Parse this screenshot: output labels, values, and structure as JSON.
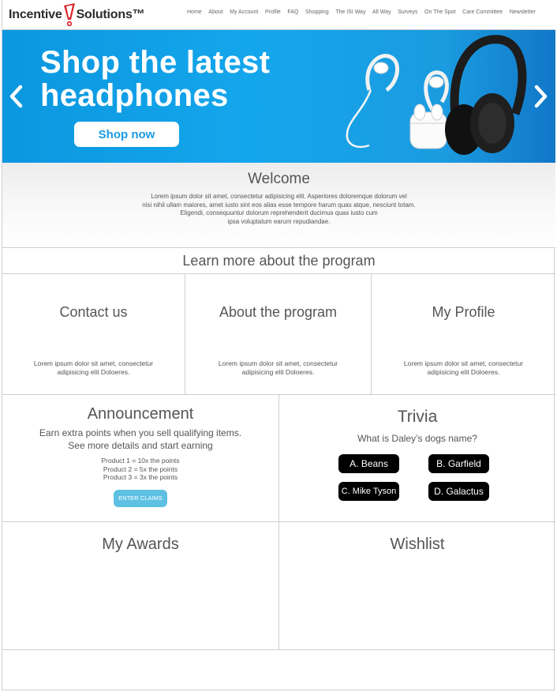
{
  "header": {
    "logo": {
      "part1": "Incentive",
      "part2": "Solutions™",
      "accent_color": "#d9262e"
    },
    "nav": [
      "Home",
      "About",
      "My Account",
      "Profile",
      "FAQ",
      "Shopping",
      "The ISI Way",
      "All Way",
      "Surveys",
      "On The Spot",
      "Care Committee",
      "Newsletter"
    ]
  },
  "banner": {
    "title_line1": "Shop the latest",
    "title_line2": "headphones",
    "cta_label": "Shop now",
    "prev_icon": "chevron-left-icon",
    "next_icon": "chevron-right-icon",
    "bg_color": "#14a6ec"
  },
  "welcome": {
    "title": "Welcome",
    "lines": [
      "Lorem ipsum dolor sit amet, consectetur adipisicing elit. Asperiores doloremque dolorum vel",
      "nisi nihil ullam maiores, amet iusto sint eos alias esse tempore harum quas atque, nesciunt totam.",
      "Eligendi, consequuntur dolorum reprehenderit ducimus quas iusto cum",
      "ipsa voluptatum earum repudiandae."
    ]
  },
  "learn": {
    "title": "Learn more about the program"
  },
  "cards": [
    {
      "title": "Contact us",
      "text": "Lorem ipsum dolor sit amet, consectetur adipisicing elit Doloeres."
    },
    {
      "title": "About the program",
      "text": "Lorem ipsum dolor sit amet, consectetur adipisicing elit Doloeres."
    },
    {
      "title": "My Profile",
      "text": "Lorem ipsum dolor sit amet, consectetur adipisicing elit Doloeres."
    }
  ],
  "announcement": {
    "title": "Announcement",
    "sub1": "Earn extra points when you sell qualifying items.",
    "sub2": "See more details and start earning",
    "products": [
      "Product 1 = 10x the points",
      "Product 2 = 5x the points",
      "Product 3 = 3x the points"
    ],
    "button": "ENTER CLAIMS"
  },
  "trivia": {
    "title": "Trivia",
    "question": "What is Daley’s dogs name?",
    "options": [
      "A. Beans",
      "B. Garfield",
      "C. Mike Tyson",
      "D. Galactus"
    ]
  },
  "awards": {
    "title": "My Awards"
  },
  "wishlist": {
    "title": "Wishlist"
  }
}
